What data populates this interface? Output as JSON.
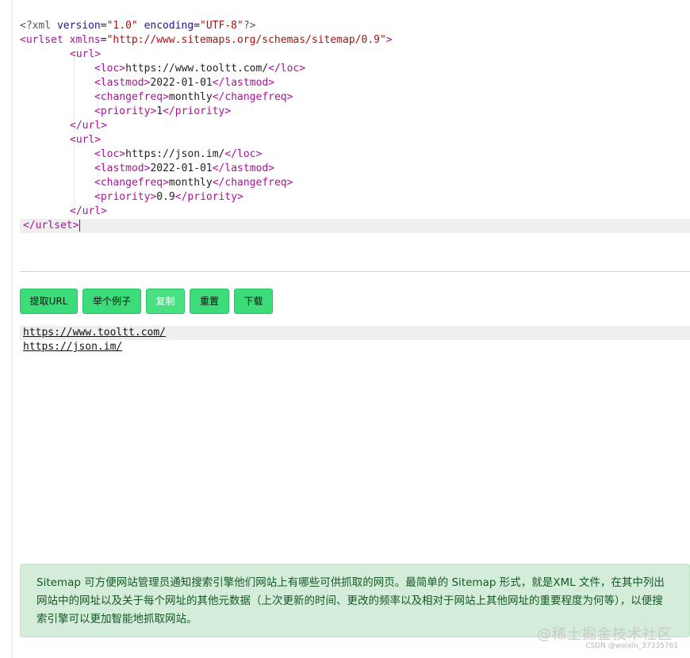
{
  "editor": {
    "prolog": {
      "open": "<?",
      "name": "xml",
      "attr1": "version",
      "val1": "\"1.0\"",
      "attr2": "encoding",
      "val2": "\"UTF-8\"",
      "close": "?>"
    },
    "urlset_open": {
      "tag": "<urlset",
      "attr": "xmlns",
      "val": "\"http://www.sitemaps.org/schemas/sitemap/0.9\"",
      "close": ">"
    },
    "url_open": "<url>",
    "url_close": "</url>",
    "urlset_close": "</urlset>",
    "entries": [
      {
        "loc": "https://www.tooltt.com/",
        "lastmod": "2022-01-01",
        "changefreq": "monthly",
        "priority": "1"
      },
      {
        "loc": "https://json.im/",
        "lastmod": "2022-01-01",
        "changefreq": "monthly",
        "priority": "0.9"
      }
    ],
    "tags": {
      "loc_open": "<loc>",
      "loc_close": "</loc>",
      "lastmod_open": "<lastmod>",
      "lastmod_close": "</lastmod>",
      "changefreq_open": "<changefreq>",
      "changefreq_close": "</changefreq>",
      "priority_open": "<priority>",
      "priority_close": "</priority>"
    }
  },
  "buttons": {
    "extract": "提取URL",
    "example": "举个例子",
    "copy": "复制",
    "reset": "重置",
    "download": "下载"
  },
  "results": [
    "https://www.tooltt.com/",
    "https://json.im/"
  ],
  "info": {
    "text": "Sitemap 可方便网站管理员通知搜索引擎他们网站上有哪些可供抓取的网页。最简单的 Sitemap 形式，就是XML 文件，在其中列出网站中的网址以及关于每个网址的其他元数据（上次更新的时间、更改的频率以及相对于网站上其他网址的重要程度为何等），以便搜索引擎可以更加智能地抓取网站。"
  },
  "watermark": {
    "main": "@稀土掘金技术社区",
    "sub": "CSDN @weixin_37335761"
  },
  "colors": {
    "button_bg": "#3ddc7a",
    "info_bg": "#d4edda",
    "info_text": "#155724",
    "xml_tag": "#aa1199",
    "xml_string": "#aa1111",
    "xml_attr": "#221199"
  }
}
